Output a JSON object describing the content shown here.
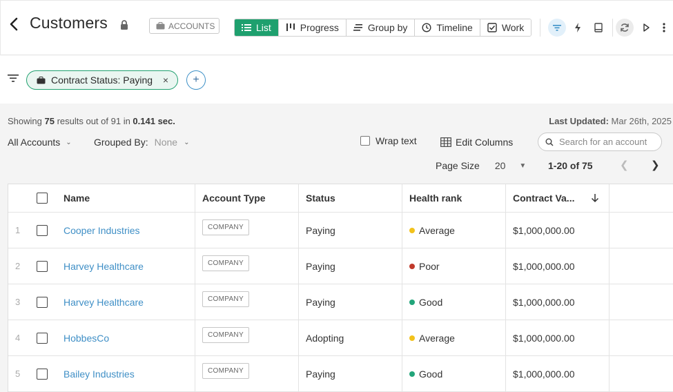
{
  "header": {
    "title": "Customers",
    "tag": "ACCOUNTS",
    "views": [
      {
        "label": "List",
        "active": true,
        "icon": "list-icon"
      },
      {
        "label": "Progress",
        "active": false,
        "icon": "progress-icon"
      },
      {
        "label": "Group by",
        "active": false,
        "icon": "group-by-icon"
      },
      {
        "label": "Timeline",
        "active": false,
        "icon": "clock-icon"
      },
      {
        "label": "Work",
        "active": false,
        "icon": "checkbox-icon"
      }
    ]
  },
  "filters": {
    "chip_label": "Contract Status: Paying",
    "remove": "×",
    "add": "+"
  },
  "summary": {
    "showing_prefix": "Showing ",
    "count": "75",
    "results_text": " results out of ",
    "total": "91",
    "in_text": " in ",
    "time": "0.141 sec.",
    "last_updated_label": "Last Updated:",
    "last_updated_value": " Mar 26th, 2025"
  },
  "controls": {
    "all_accounts": "All Accounts",
    "grouped_by_label": "Grouped By:",
    "grouped_by_value": "None",
    "wrap_text": "Wrap text",
    "edit_columns": "Edit Columns",
    "search_placeholder": "Search for an account",
    "page_size_label": "Page Size",
    "page_size_value": "20",
    "pager": "1-20 of 75"
  },
  "table": {
    "columns": [
      "Name",
      "Account Type",
      "Status",
      "Health rank",
      "Contract Va..."
    ],
    "rows": [
      {
        "index": "1",
        "name": "Cooper Industries",
        "type": "COMPANY",
        "status": "Paying",
        "health": "Average",
        "health_color": "#f2c21b",
        "value": "$1,000,000.00"
      },
      {
        "index": "2",
        "name": "Harvey Healthcare",
        "type": "COMPANY",
        "status": "Paying",
        "health": "Poor",
        "health_color": "#c0392b",
        "value": "$1,000,000.00"
      },
      {
        "index": "3",
        "name": "Harvey Healthcare",
        "type": "COMPANY",
        "status": "Paying",
        "health": "Good",
        "health_color": "#22a57a",
        "value": "$1,000,000.00"
      },
      {
        "index": "4",
        "name": "HobbesCo",
        "type": "COMPANY",
        "status": "Adopting",
        "health": "Average",
        "health_color": "#f2c21b",
        "value": "$1,000,000.00"
      },
      {
        "index": "5",
        "name": "Bailey Industries",
        "type": "COMPANY",
        "status": "Paying",
        "health": "Good",
        "health_color": "#22a57a",
        "value": "$1,000,000.00"
      }
    ]
  }
}
